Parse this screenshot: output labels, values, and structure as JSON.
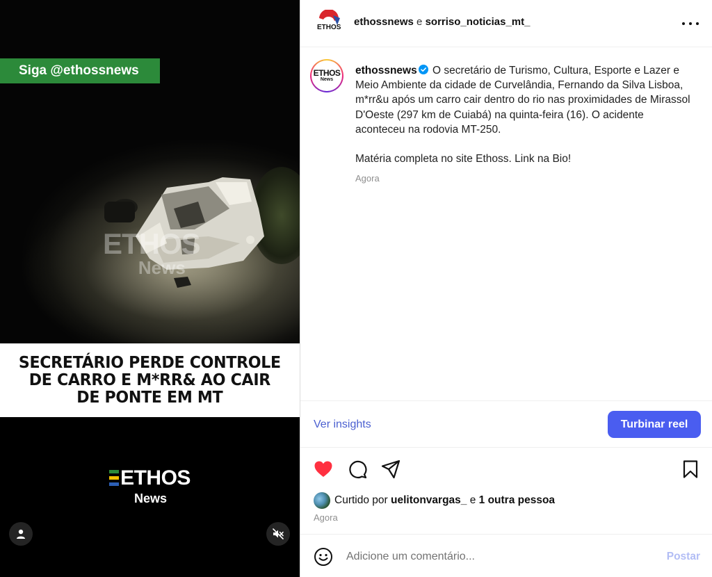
{
  "media": {
    "follow_banner": "Siga @ethossnews",
    "watermark_main": "ETHOS",
    "watermark_sub": "News",
    "headline_line1": "SECRETÁRIO PERDE CONTROLE",
    "headline_line2": "DE CARRO E M*RR& AO CAIR",
    "headline_line3": "DE PONTE EM MT",
    "logo_main": "ETHOS",
    "logo_sub": "News",
    "icons": {
      "user": "user-icon",
      "mute": "muted-speaker-icon"
    }
  },
  "header": {
    "avatar_text": "ETHOS",
    "author": "ethossnews",
    "connector": "e",
    "collaborator": "sorriso_noticias_mt_",
    "more_icon": "more-options-icon"
  },
  "post": {
    "avatar_text_main": "ETHOS",
    "avatar_text_sub": "News",
    "author": "ethossnews",
    "caption_p1": "O secretário de Turismo, Cultura, Esporte e Lazer e Meio Ambiente da cidade de Curvelândia, Fernando da Silva Lisboa, m*rr&u após um carro cair dentro do rio nas proximidades de Mirassol D'Oeste (297 km de Cuiabá) na quinta-feira (16). O acidente aconteceu na rodovia MT-250.",
    "caption_p2": "Matéria completa no site Ethoss. Link na Bio!",
    "time": "Agora"
  },
  "insights": {
    "link": "Ver insights",
    "boost": "Turbinar reel"
  },
  "actions": {
    "like_icon": "heart-filled-icon",
    "comment_icon": "comment-icon",
    "share_icon": "share-icon",
    "save_icon": "bookmark-icon",
    "liked": true
  },
  "likes": {
    "prefix": "Curtido por",
    "user": "uelitonvargas_",
    "connector": "e",
    "others": "1 outra pessoa",
    "time": "Agora"
  },
  "comment": {
    "placeholder": "Adicione um comentário...",
    "value": "",
    "post": "Postar",
    "emoji_icon": "emoji-icon"
  },
  "colors": {
    "accent": "#4a5df0",
    "link": "#4a5fd0",
    "like": "#ff3040",
    "banner_green": "#2c8a3a"
  }
}
